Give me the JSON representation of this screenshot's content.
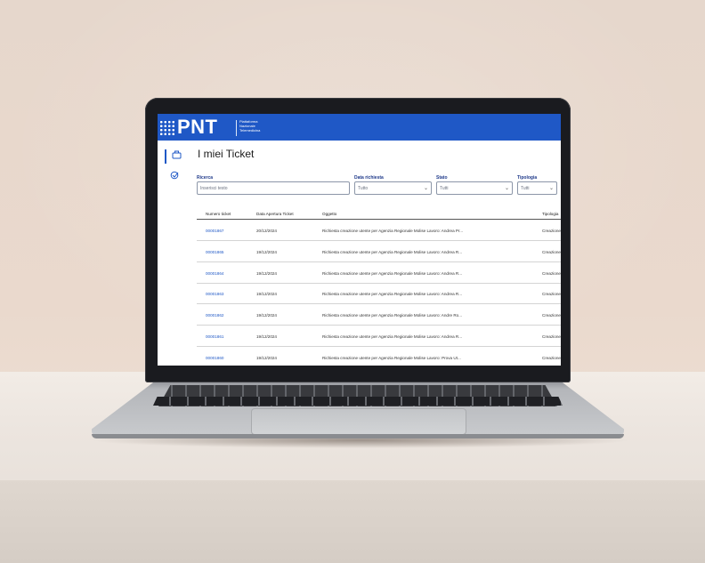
{
  "app": {
    "logo": "PNT",
    "logo_subtitle": [
      "Piattaforma",
      "Nazionale",
      "Telemedicina"
    ],
    "brand_color": "#1f58c6"
  },
  "sidebar": {
    "items": [
      {
        "icon": "briefcase-icon",
        "active": true
      },
      {
        "icon": "edit-check-icon",
        "active": false
      }
    ]
  },
  "page": {
    "title": "I miei Ticket"
  },
  "filters": {
    "search": {
      "label": "Ricerca",
      "placeholder": "Inserisci testo"
    },
    "date": {
      "label": "Data richiesta",
      "value": "Tutto"
    },
    "status": {
      "label": "Stato",
      "value": "Tutti"
    },
    "type": {
      "label": "Tipologia",
      "value": "Tutti"
    }
  },
  "table": {
    "columns": [
      "Numero ticket",
      "Data Apertura Ticket",
      "Oggetto",
      "Tipologia"
    ],
    "rows": [
      {
        "number": "00001867",
        "date": "20/12/2024",
        "subject": "Richiesta creazione utente per Agenzia Regionale Molise Lavoro: Andrea Pr...",
        "type": "Creazione"
      },
      {
        "number": "00001865",
        "date": "19/12/2024",
        "subject": "Richiesta creazione utente per Agenzia Regionale Molise Lavoro: Andrea R...",
        "type": "Creazione"
      },
      {
        "number": "00001864",
        "date": "19/12/2024",
        "subject": "Richiesta creazione utente per Agenzia Regionale Molise Lavoro: Andrea R...",
        "type": "Creazione"
      },
      {
        "number": "00001863",
        "date": "19/12/2024",
        "subject": "Richiesta creazione utente per Agenzia Regionale Molise Lavoro: Andrea R...",
        "type": "Creazione"
      },
      {
        "number": "00001862",
        "date": "19/12/2024",
        "subject": "Richiesta creazione utente per Agenzia Regionale Molise Lavoro: Andre Ro...",
        "type": "Creazione"
      },
      {
        "number": "00001861",
        "date": "19/12/2024",
        "subject": "Richiesta creazione utente per Agenzia Regionale Molise Lavoro: Andrea R...",
        "type": "Creazione"
      },
      {
        "number": "00001860",
        "date": "19/12/2024",
        "subject": "Richiesta creazione utente per Agenzia Regionale Molise Lavoro: Prova Ut...",
        "type": "Creazione"
      }
    ]
  }
}
